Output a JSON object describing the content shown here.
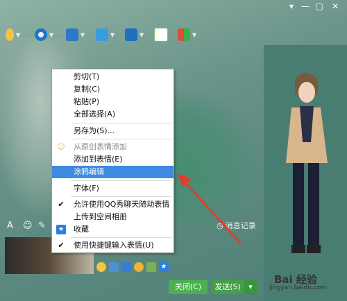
{
  "window": {
    "title": ""
  },
  "menu": {
    "items": [
      {
        "label": "剪切(T)",
        "disabled": false
      },
      {
        "label": "复制(C)",
        "disabled": false
      },
      {
        "label": "粘贴(P)",
        "disabled": false
      },
      {
        "label": "全部选择(A)",
        "disabled": false
      },
      {
        "label": "另存为(S)...",
        "disabled": false
      },
      {
        "label": "从原创表情添加",
        "disabled": true
      },
      {
        "label": "添加到表情(E)",
        "disabled": false
      },
      {
        "label": "涂鸦编辑",
        "disabled": false,
        "highlighted": true
      },
      {
        "label": "字体(F)",
        "disabled": false
      },
      {
        "label": "允许使用QQ秀聊天随动表情",
        "disabled": false,
        "checked": true
      },
      {
        "label": "上传到空间相册",
        "disabled": false
      },
      {
        "label": "收藏",
        "disabled": false
      },
      {
        "label": "使用快捷键输入表情(U)",
        "disabled": false,
        "checked": true
      }
    ]
  },
  "input": {
    "message_record_label": "消息记录"
  },
  "buttons": {
    "close_label": "关闭(C)",
    "send_label": "发送(S)"
  },
  "watermark": {
    "brand": "Bai 经验",
    "url": "jingyan.baidu.com"
  },
  "colors": {
    "highlight": "#3d8ae0",
    "panel_bg": "#6f9a8b",
    "arrow": "#e53b2c"
  }
}
